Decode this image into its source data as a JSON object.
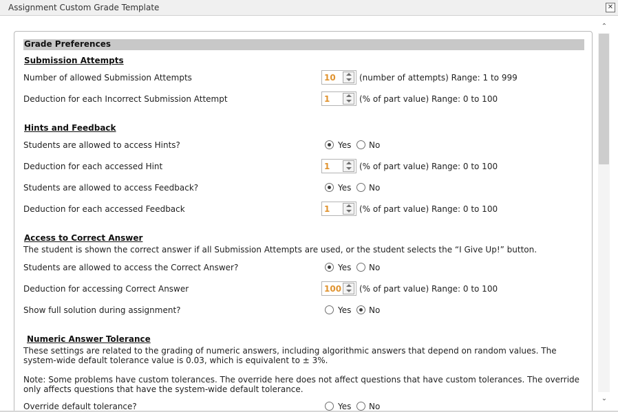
{
  "window": {
    "title": "Assignment Custom Grade Template",
    "close_symbol": "✕"
  },
  "scrollbar": {
    "up_symbol": "⌃",
    "down_symbol": "⌄"
  },
  "section_title": "Grade Preferences",
  "submission": {
    "heading": "Submission Attempts",
    "attempts_label": "Number of allowed Submission Attempts",
    "attempts_value": "10",
    "attempts_unit": "(number of attempts) Range: 1 to 999",
    "deduction_label": "Deduction for each Incorrect Submission Attempt",
    "deduction_value": "1",
    "deduction_unit": "(% of part value) Range: 0 to 100"
  },
  "hints": {
    "heading": "Hints and Feedback",
    "hints_label": "Students are allowed to access Hints?",
    "hints_selected": "yes",
    "hint_deduction_label": "Deduction for each accessed Hint",
    "hint_deduction_value": "1",
    "hint_deduction_unit": "(% of part value) Range: 0 to 100",
    "feedback_label": "Students are allowed to access Feedback?",
    "feedback_selected": "yes",
    "feedback_deduction_label": "Deduction for each accessed Feedback",
    "feedback_deduction_value": "1",
    "feedback_deduction_unit": "(% of part value) Range: 0 to 100"
  },
  "correct_answer": {
    "heading": "Access to Correct Answer",
    "description": "The student is shown the correct answer if all Submission Attempts are used, or the student selects the “I Give Up!” button.",
    "access_label": "Students are allowed to access the Correct Answer?",
    "access_selected": "yes",
    "deduction_label": "Deduction for accessing Correct Answer",
    "deduction_value": "100",
    "deduction_unit": "(% of part value) Range: 0 to 100",
    "solution_label": "Show full solution during assignment?",
    "solution_selected": "no"
  },
  "tolerance": {
    "heading": "Numeric Answer Tolerance",
    "description": "These settings are related to the grading of numeric answers, including algorithmic answers that depend on random values. The system-wide default tolerance value is 0.03, which is equivalent to ± 3%.",
    "note": "Note: Some problems have custom tolerances. The override here does not affect questions that have custom tolerances. The override only affects questions that have the system-wide default tolerance.",
    "override_label": "Override default tolerance?"
  },
  "options": {
    "yes": "Yes",
    "no": "No"
  },
  "colors": {
    "value_text": "#e0932f",
    "section_bar": "#c8c8c8"
  }
}
